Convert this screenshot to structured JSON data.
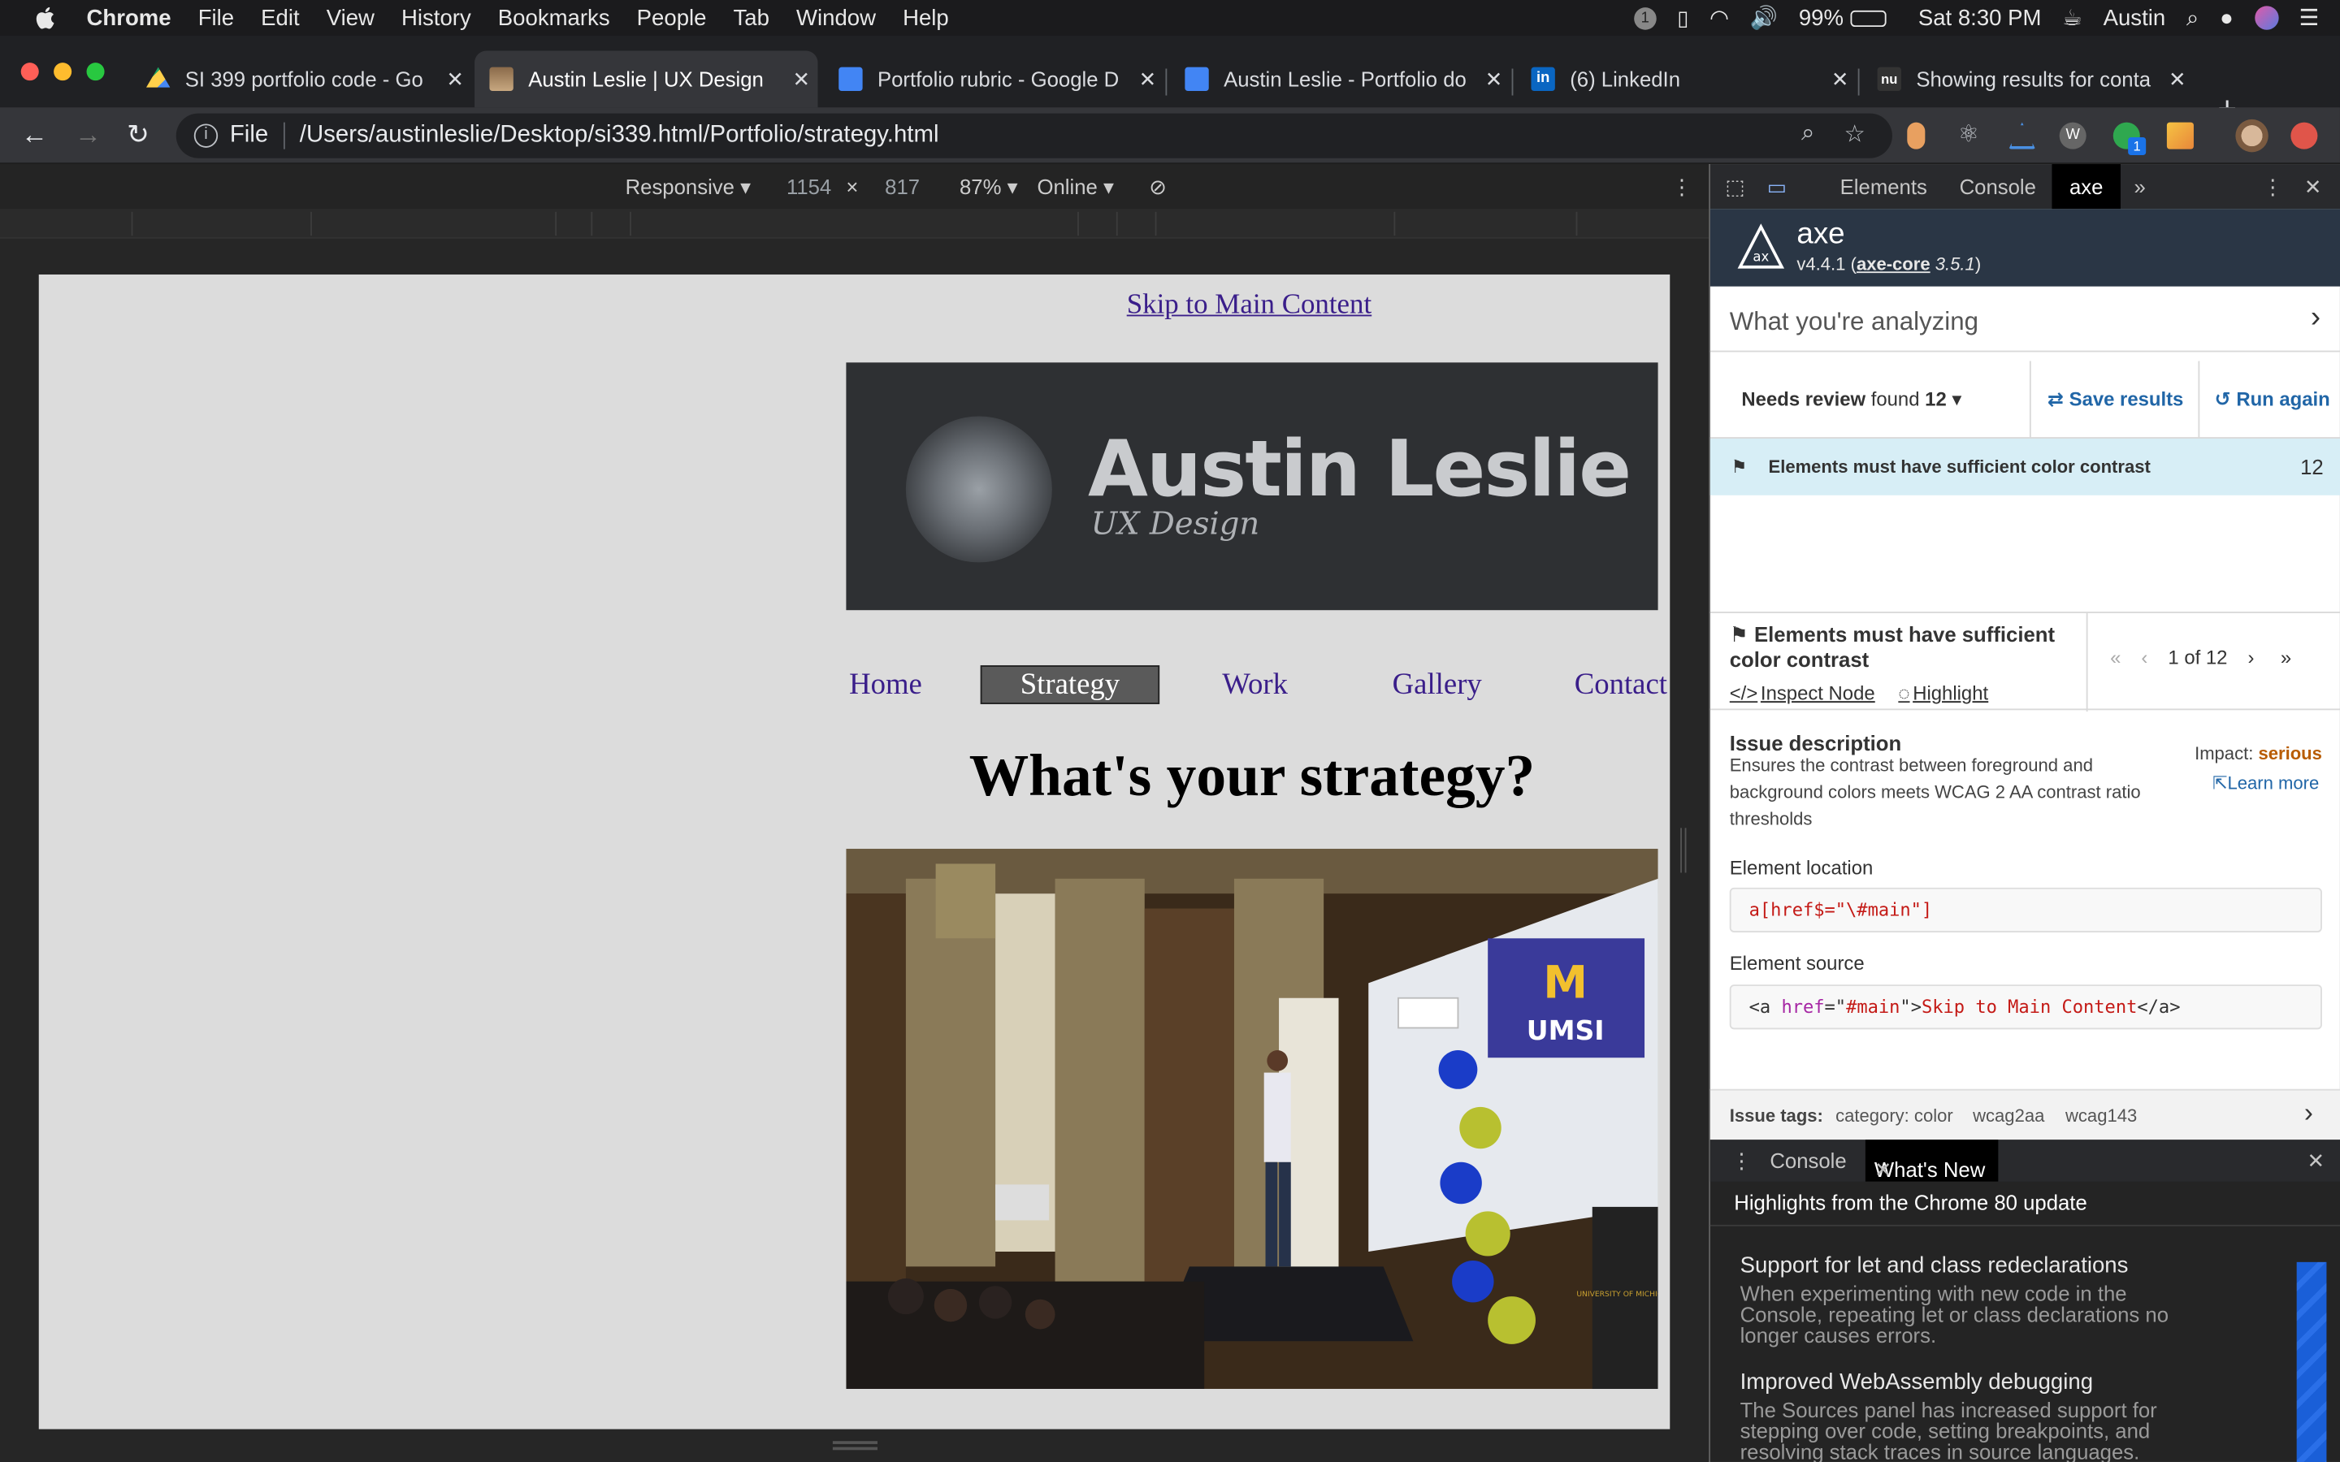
{
  "menubar": {
    "app": "Chrome",
    "items": [
      "File",
      "Edit",
      "View",
      "History",
      "Bookmarks",
      "People",
      "Tab",
      "Window",
      "Help"
    ],
    "notif": "1",
    "battery": "99%",
    "clock": "Sat 8:30 PM",
    "user": "Austin"
  },
  "tabs": [
    {
      "title": "SI 399 portfolio code - Go",
      "icon": "google-drive-icon"
    },
    {
      "title": "Austin Leslie | UX Design",
      "icon": "page-favicon",
      "active": true
    },
    {
      "title": "Portfolio rubric - Google D",
      "icon": "google-docs-icon"
    },
    {
      "title": "Austin Leslie - Portfolio do",
      "icon": "google-docs-icon"
    },
    {
      "title": "(6) LinkedIn",
      "icon": "linkedin-icon"
    },
    {
      "title": "Showing results for conta",
      "icon": "nu-icon"
    }
  ],
  "address": {
    "scheme": "File",
    "url": "/Users/austinleslie/Desktop/si339.html/Portfolio/strategy.html"
  },
  "device_toolbar": {
    "mode": "Responsive",
    "width": "1154",
    "times": "×",
    "height": "817",
    "zoom": "87%",
    "network": "Online"
  },
  "page": {
    "skip_link": "Skip to Main Content",
    "brand_name": "Austin Leslie",
    "brand_sub": "UX Design",
    "nav": [
      "Home",
      "Strategy",
      "Work",
      "Gallery",
      "Contact"
    ],
    "heading": "What's your strategy?",
    "photo_text": {
      "screen_line1": "UMSI",
      "podium": "UNIVERSITY OF MICHIGAN"
    }
  },
  "devtools": {
    "tabs": [
      "Elements",
      "Console",
      "axe"
    ],
    "more": "»",
    "axe": {
      "title": "axe",
      "version": "v4.4.1",
      "core_name": "axe-core",
      "core_version": "3.5.1",
      "analyzing": "What you're analyzing",
      "needs_review": "Needs review",
      "found_label": "found",
      "found_count": "12",
      "save_results": "Save results",
      "run_again": "Run again",
      "issue_label": "Elements must have sufficient color contrast",
      "issue_count": "12",
      "detail_title": "Elements must have sufficient color contrast",
      "inspect_node": "Inspect Node",
      "highlight": "Highlight",
      "pager": "1 of 12",
      "issue_description_h": "Issue description",
      "issue_description": "Ensures the contrast between foreground and background colors meets WCAG 2 AA contrast ratio thresholds",
      "impact_label": "Impact:",
      "impact_value": "serious",
      "learn_more": "Learn more",
      "element_location_h": "Element location",
      "element_location": "a[href$=\"\\#main\"]",
      "element_source_h": "Element source",
      "source_tag_open": "<a ",
      "source_attr": "href",
      "source_eq": "=\"",
      "source_val": "#main",
      "source_close": "\">",
      "source_text": "Skip to Main Content",
      "source_tag_end": "</a>",
      "issue_tags_label": "Issue tags:",
      "tags": [
        "category: color",
        "wcag2aa",
        "wcag143"
      ]
    },
    "drawer": {
      "tabs": [
        "Console",
        "What's New"
      ],
      "subhead": "Highlights from the Chrome 80 update",
      "items": [
        {
          "title": "Support for let and class redeclarations",
          "desc": "When experimenting with new code in the Console, repeating let or class declarations no longer causes errors."
        },
        {
          "title": "Improved WebAssembly debugging",
          "desc": "The Sources panel has increased support for stepping over code, setting breakpoints, and resolving stack traces in source languages."
        }
      ]
    }
  },
  "colors": {
    "link": "#3a1e8a",
    "axe_header": "#2a3645",
    "accent_blue": "#2166a7",
    "impact_serious": "#b85c00",
    "issue_row_bg": "#d7eef6"
  }
}
